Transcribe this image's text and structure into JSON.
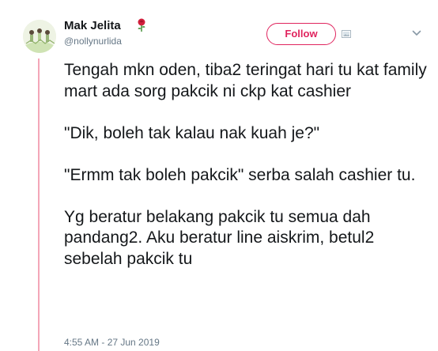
{
  "author": {
    "display_name": "Mak Jelita",
    "handle": "@nollynurlida",
    "emoji": "🌹"
  },
  "actions": {
    "follow_label": "Follow"
  },
  "tweet": {
    "text": "Tengah mkn oden, tiba2 teringat hari tu kat family mart ada sorg pakcik ni ckp kat cashier\n\n\"Dik, boleh tak kalau nak kuah je?\"\n\n\"Ermm tak boleh pakcik\" serba salah cashier tu.\n\nYg beratur belakang pakcik tu semua dah pandang2. Aku beratur line aiskrim, betul2 sebelah pakcik tu",
    "timestamp": "4:55 AM - 27 Jun 2019"
  },
  "colors": {
    "accent": "#e0245e",
    "thread_line": "#f4a6b8",
    "text": "#14171a",
    "muted": "#657786"
  },
  "icons": [
    "rose-icon",
    "media-icon",
    "chevron-down-icon"
  ]
}
